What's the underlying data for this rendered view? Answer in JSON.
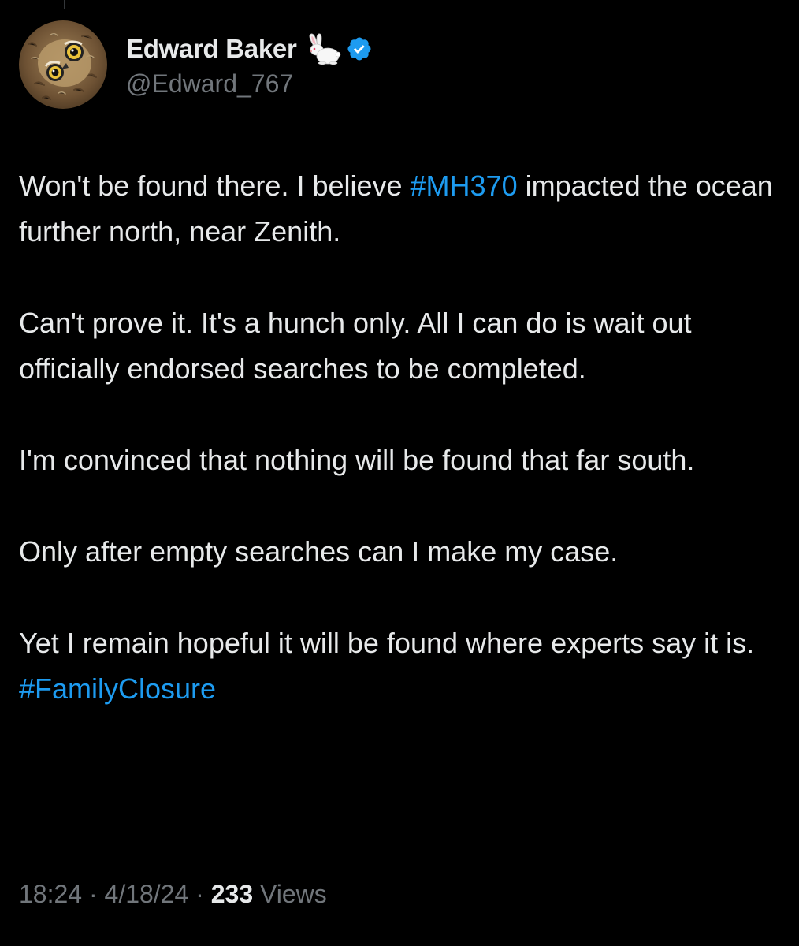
{
  "author": {
    "display_name": "Edward Baker",
    "handle": "@Edward_767",
    "name_emoji": "rabbit-icon",
    "verified": true,
    "avatar": "owl-avatar"
  },
  "tweet": {
    "p1_text": "Won't be found there. I believe ",
    "p1_hashtag": "#MH370",
    "p1_text_after": " impacted the ocean further north, near Zenith.",
    "p2": "Can't prove it. It's a hunch only. All I can do is wait out officially endorsed searches to be completed.",
    "p3": "I'm convinced that nothing will be found that far south.",
    "p4": "Only after empty searches can I make my case.",
    "p5_text": "Yet I remain hopeful it will be found where experts say it is. ",
    "p5_hashtag": "#FamilyClosure"
  },
  "meta": {
    "time": "18:24",
    "sep1": " · ",
    "date": "4/18/24",
    "sep2": " · ",
    "views_count": "233",
    "views_label": " Views"
  },
  "colors": {
    "background": "#000000",
    "text": "#e7e9ea",
    "muted": "#71767b",
    "accent": "#1d9bf0"
  }
}
